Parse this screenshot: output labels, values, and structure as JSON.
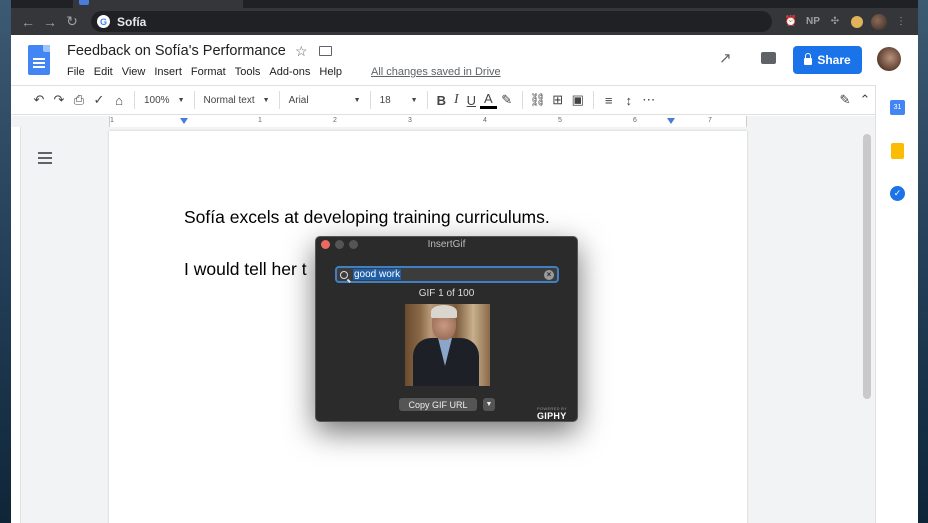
{
  "browser": {
    "omnibox_text": "Sofía",
    "extensions": [
      "NP"
    ]
  },
  "docs": {
    "title": "Feedback on Sofía's Performance",
    "menu": [
      "File",
      "Edit",
      "View",
      "Insert",
      "Format",
      "Tools",
      "Add-ons",
      "Help"
    ],
    "saved_status": "All changes saved in Drive",
    "share_label": "Share",
    "toolbar": {
      "zoom": "100%",
      "style": "Normal text",
      "font": "Arial",
      "size": "18",
      "bold": "B",
      "italic": "I",
      "underline": "U",
      "text_color": "A"
    },
    "ruler_numbers": [
      "1",
      "1",
      "2",
      "3",
      "4",
      "5",
      "6",
      "7"
    ],
    "paragraphs": [
      "Sofía excels at developing training curriculums.",
      "I would tell her t"
    ],
    "calendar_label": "31"
  },
  "gif_dialog": {
    "title": "InsertGif",
    "search_value": "good work",
    "count": "GIF 1 of 100",
    "copy_label": "Copy GIF URL",
    "powered": "POWERED BY",
    "brand": "GIPHY"
  },
  "colors": {
    "share_blue": "#1a73e8",
    "docs_blue": "#4285f4",
    "dialog_bg": "#2b2b2b",
    "search_focus": "#3f7fc4"
  }
}
